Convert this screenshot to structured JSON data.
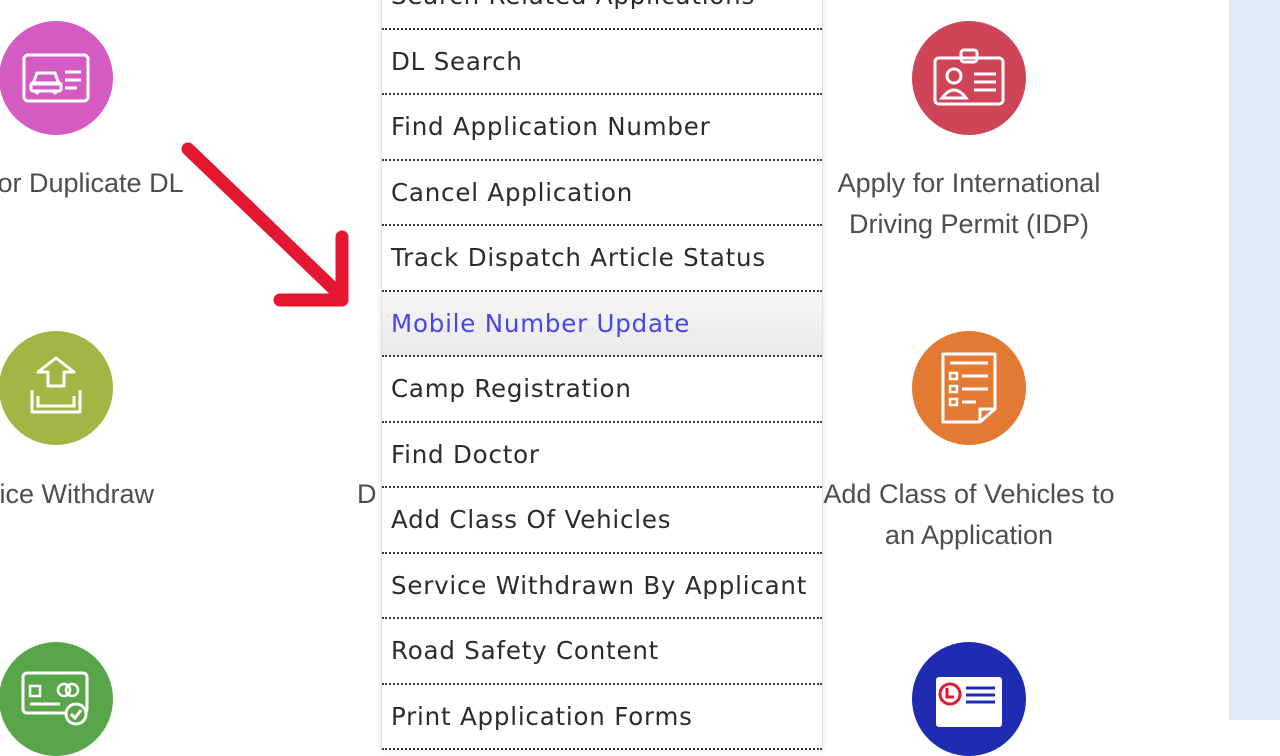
{
  "colors": {
    "pink": "#d35bc2",
    "red": "#cf4557",
    "olive": "#a4b546",
    "orange": "#e27a33",
    "green": "#58a54a",
    "blue": "#1f2bb0",
    "arrow": "#e3172f",
    "menu_highlight": "#4747e6"
  },
  "tiles": {
    "dup_dl": {
      "icon": "driving-licence-card-icon",
      "label": "for Duplicate DL"
    },
    "idp": {
      "icon": "id-badge-icon",
      "label_line1": "Apply for International",
      "label_line2": "Driving Permit (IDP)"
    },
    "withdraw": {
      "icon": "upload-tray-icon",
      "label": "vice Withdraw"
    },
    "middle_partial": {
      "label": "D"
    },
    "add_cov": {
      "icon": "form-document-icon",
      "label_line1": "Add Class of Vehicles to",
      "label_line2": "an Application"
    },
    "bottom_left": {
      "icon": "card-check-icon"
    },
    "bottom_right": {
      "icon": "learner-licence-icon"
    }
  },
  "menu": {
    "items": [
      "Search Related Applications",
      "DL Search",
      "Find Application Number",
      "Cancel Application",
      "Track Dispatch Article Status",
      "Mobile Number Update",
      "Camp Registration",
      "Find Doctor",
      "Add Class Of Vehicles",
      "Service Withdrawn By Applicant",
      "Road Safety Content",
      "Print Application Forms"
    ],
    "active_index": 5
  }
}
